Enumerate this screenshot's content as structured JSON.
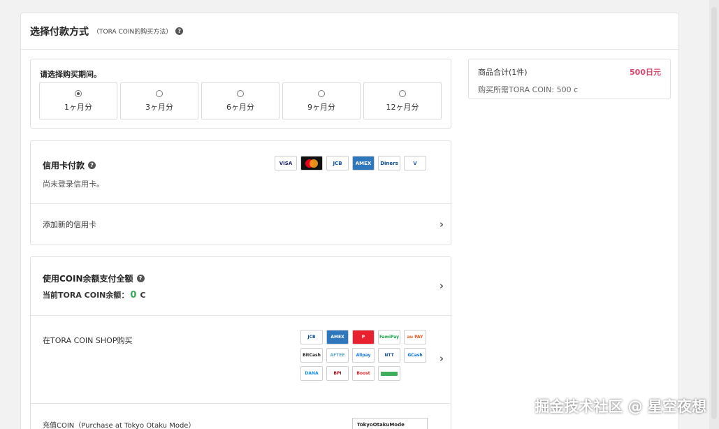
{
  "header": {
    "title": "选择付款方式",
    "subtitle": "（TORA COIN的购买方法）"
  },
  "period": {
    "label": "请选择购买期间。",
    "options": [
      {
        "label": "1ヶ月分",
        "selected": true
      },
      {
        "label": "3ヶ月分",
        "selected": false
      },
      {
        "label": "6ヶ月分",
        "selected": false
      },
      {
        "label": "9ヶ月分",
        "selected": false
      },
      {
        "label": "12ヶ月分",
        "selected": false
      }
    ]
  },
  "credit_card": {
    "title": "信用卡付款",
    "note": "尚未登录信用卡。",
    "add_label": "添加新的信用卡",
    "logos": [
      {
        "name": "visa-logo",
        "text": "VISA",
        "bg": "#ffffff",
        "fg": "#1a1f71"
      },
      {
        "name": "mastercard-logo",
        "text": "",
        "bg": "#111111",
        "fg": "#ffffff"
      },
      {
        "name": "jcb-logo",
        "text": "JCB",
        "bg": "#ffffff",
        "fg": "#0b4ea2"
      },
      {
        "name": "amex-logo",
        "text": "AMEX",
        "bg": "#2e77bc",
        "fg": "#ffffff"
      },
      {
        "name": "diners-club-logo",
        "text": "Diners",
        "bg": "#ffffff",
        "fg": "#0a4c8c"
      },
      {
        "name": "v-preca-logo",
        "text": "V",
        "bg": "#ffffff",
        "fg": "#2a5fb0"
      }
    ]
  },
  "coin": {
    "title": "使用COIN余额支付全额",
    "balance_prefix": "当前TORA COIN余额：",
    "balance_value": "0",
    "balance_unit": "C"
  },
  "shop": {
    "label": "在TORA COIN SHOP购买",
    "logos": [
      {
        "name": "jcb-logo",
        "text": "JCB",
        "bg": "#ffffff",
        "fg": "#0b4ea2"
      },
      {
        "name": "amex-logo",
        "text": "AMEX",
        "bg": "#2e77bc",
        "fg": "#ffffff"
      },
      {
        "name": "paypay-logo",
        "text": "P",
        "bg": "#e8202f",
        "fg": "#ffffff"
      },
      {
        "name": "famipay-logo",
        "text": "FamiPay",
        "bg": "#ffffff",
        "fg": "#1ba048"
      },
      {
        "name": "au-pay-logo",
        "text": "au PAY",
        "bg": "#ffffff",
        "fg": "#e8571e"
      },
      {
        "name": "bitcash-logo",
        "text": "BitCash",
        "bg": "#ffffff",
        "fg": "#222222"
      },
      {
        "name": "aftee-logo",
        "text": "AFTEE",
        "bg": "#ffffff",
        "fg": "#6aa6c8"
      },
      {
        "name": "alipay-logo",
        "text": "Alipay",
        "bg": "#ffffff",
        "fg": "#1677ff"
      },
      {
        "name": "ntt-logo",
        "text": "NTT",
        "bg": "#ffffff",
        "fg": "#1d4f9c"
      },
      {
        "name": "gcash-logo",
        "text": "GCash",
        "bg": "#ffffff",
        "fg": "#0070e0"
      },
      {
        "name": "dana-logo",
        "text": "DANA",
        "bg": "#ffffff",
        "fg": "#118ee9"
      },
      {
        "name": "bpi-logo",
        "text": "BPI",
        "bg": "#ffffff",
        "fg": "#a00d1a"
      },
      {
        "name": "boost-logo",
        "text": "Boost",
        "bg": "#ffffff",
        "fg": "#e3232a"
      },
      {
        "name": "green-logo",
        "text": "",
        "bg": "#ffffff",
        "fg": "#3fae5a"
      }
    ]
  },
  "tokyo": {
    "label": "充值COIN（Purchase at Tokyo Otaku Mode）",
    "logo_text": "TokyoOtakuMode"
  },
  "summary": {
    "label": "商品合计(1件)",
    "price": "500日元",
    "coins_needed": "购买所需TORA COIN: 500 c"
  },
  "watermark": "掘金技术社区 @ 星空夜想",
  "colors": {
    "price_accent": "#d9486d",
    "balance_green": "#3aaa5c"
  }
}
